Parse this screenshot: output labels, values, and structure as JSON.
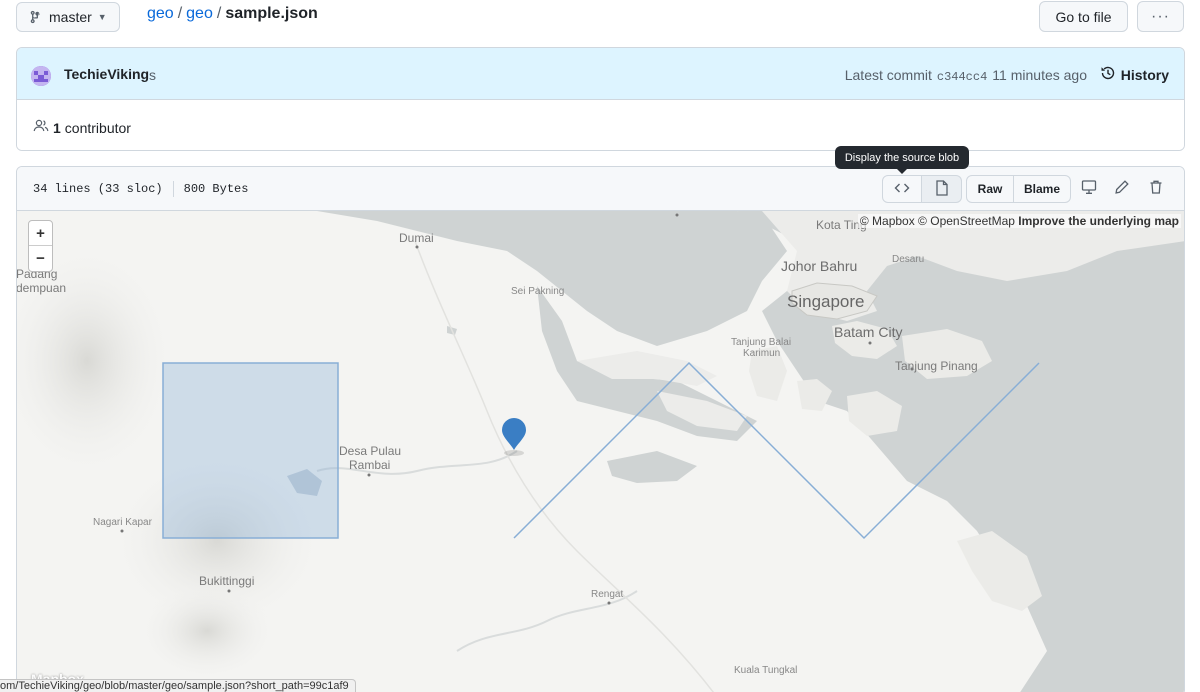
{
  "header": {
    "branch": "master",
    "breadcrumb": [
      "geo",
      "geo"
    ],
    "separator": "/",
    "filename": "sample.json",
    "goto_file": "Go to file",
    "more": "···"
  },
  "commit": {
    "author": "TechieViking",
    "message": "s",
    "latest_label": "Latest commit",
    "sha": "c344cc4",
    "time": "11 minutes ago",
    "history": "History"
  },
  "contributors": {
    "count": "1",
    "label": "contributor"
  },
  "file": {
    "lines": "34 lines (33 sloc)",
    "size": "800 Bytes",
    "raw": "Raw",
    "blame": "Blame",
    "tooltip": "Display the source blob"
  },
  "map": {
    "zoom_in": "+",
    "zoom_out": "−",
    "attribution_prefix": "© Mapbox © OpenStreetMap",
    "attribution_link": "Improve the underlying map",
    "logo": "Mapbox",
    "labels": {
      "dumai": "Dumai",
      "kota_tinggi": "Kota Ting",
      "johor_bahru": "Johor Bahru",
      "desaru": "Desaru",
      "singapore": "Singapore",
      "batam_city": "Batam City",
      "sei_pakning": "Sei Pakning",
      "tanjung_balai": "Tanjung Balai",
      "karimun": "Karimun",
      "tanjung_pinang": "Tanjung Pinang",
      "padang": "Padang",
      "sidempuan": "dempuan",
      "desa_pulau": "Desa Pulau",
      "rambai": "Rambai",
      "nagari_kapar": "Nagari Kapar",
      "bukittinggi": "Bukittinggi",
      "rengat": "Rengat",
      "kuala_tungkal": "Kuala Tungkal"
    },
    "feature_color": "#88aed6",
    "marker_color": "#3a7ec4"
  },
  "status_url": "om/TechieViking/geo/blob/master/geo/sample.json?short_path=99c1af9"
}
